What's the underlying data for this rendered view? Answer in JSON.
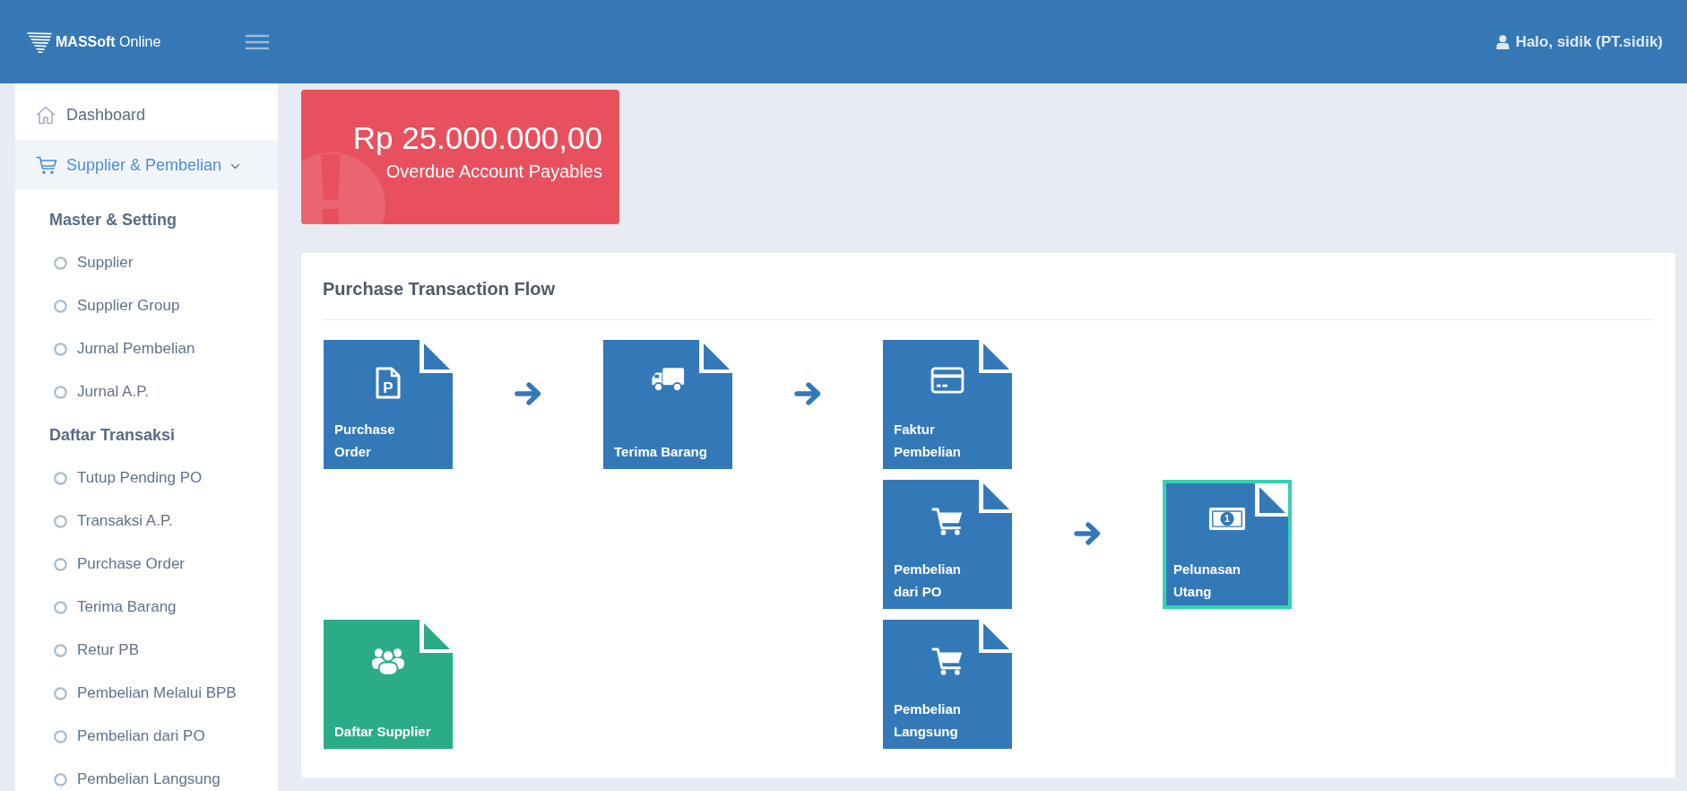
{
  "header": {
    "logo": "**MASSoft** Online",
    "greeting": "Halo, sidik (PT.sidik)"
  },
  "sidebar": {
    "items": [
      {
        "label": "Dashboard",
        "kind": "home",
        "selected": false
      },
      {
        "label": "Supplier & Pembelian",
        "kind": "cart",
        "selected": true,
        "expanded": true,
        "sections": [
          {
            "heading": "Master & Setting",
            "links": [
              "Supplier",
              "Supplier Group",
              "Jurnal Pembelian",
              "Jurnal A.P."
            ]
          },
          {
            "heading": "Daftar Transaksi",
            "links": [
              "Tutup Pending PO",
              "Transaksi A.P.",
              "Purchase Order",
              "Terima Barang",
              "Retur PB",
              "Pembelian Melalui BPB",
              "Pembelian dari PO",
              "Pembelian Langsung"
            ]
          }
        ]
      }
    ]
  },
  "summary_card": {
    "amount": "Rp 25.000.000,00",
    "caption": "Overdue Account Payables"
  },
  "flow": {
    "title": "Purchase Transaction Flow",
    "nodes": [
      {
        "label": "Purchase Order",
        "kind": "order",
        "symbol": "P",
        "color": "#3379b8",
        "selected": false
      },
      {
        "label": "Terima Barang",
        "kind": "delivery",
        "color": "#3379b8",
        "selected": false
      },
      {
        "label": "Faktur Pembelian",
        "kind": "invoice",
        "color": "#3379b8",
        "selected": false
      },
      {
        "label": "Pembelian dari PO",
        "kind": "cart",
        "color": "#3379b8",
        "selected": false
      },
      {
        "label": "Pelunasan Utang",
        "kind": "payment",
        "symbol": "1",
        "color": "#3379b8",
        "selected": true
      },
      {
        "label": "Daftar Supplier",
        "kind": "group",
        "color": "#2aac87",
        "selected": false
      },
      {
        "label": "Pembelian Langsung",
        "kind": "cart",
        "color": "#3379b8",
        "selected": false
      }
    ]
  }
}
